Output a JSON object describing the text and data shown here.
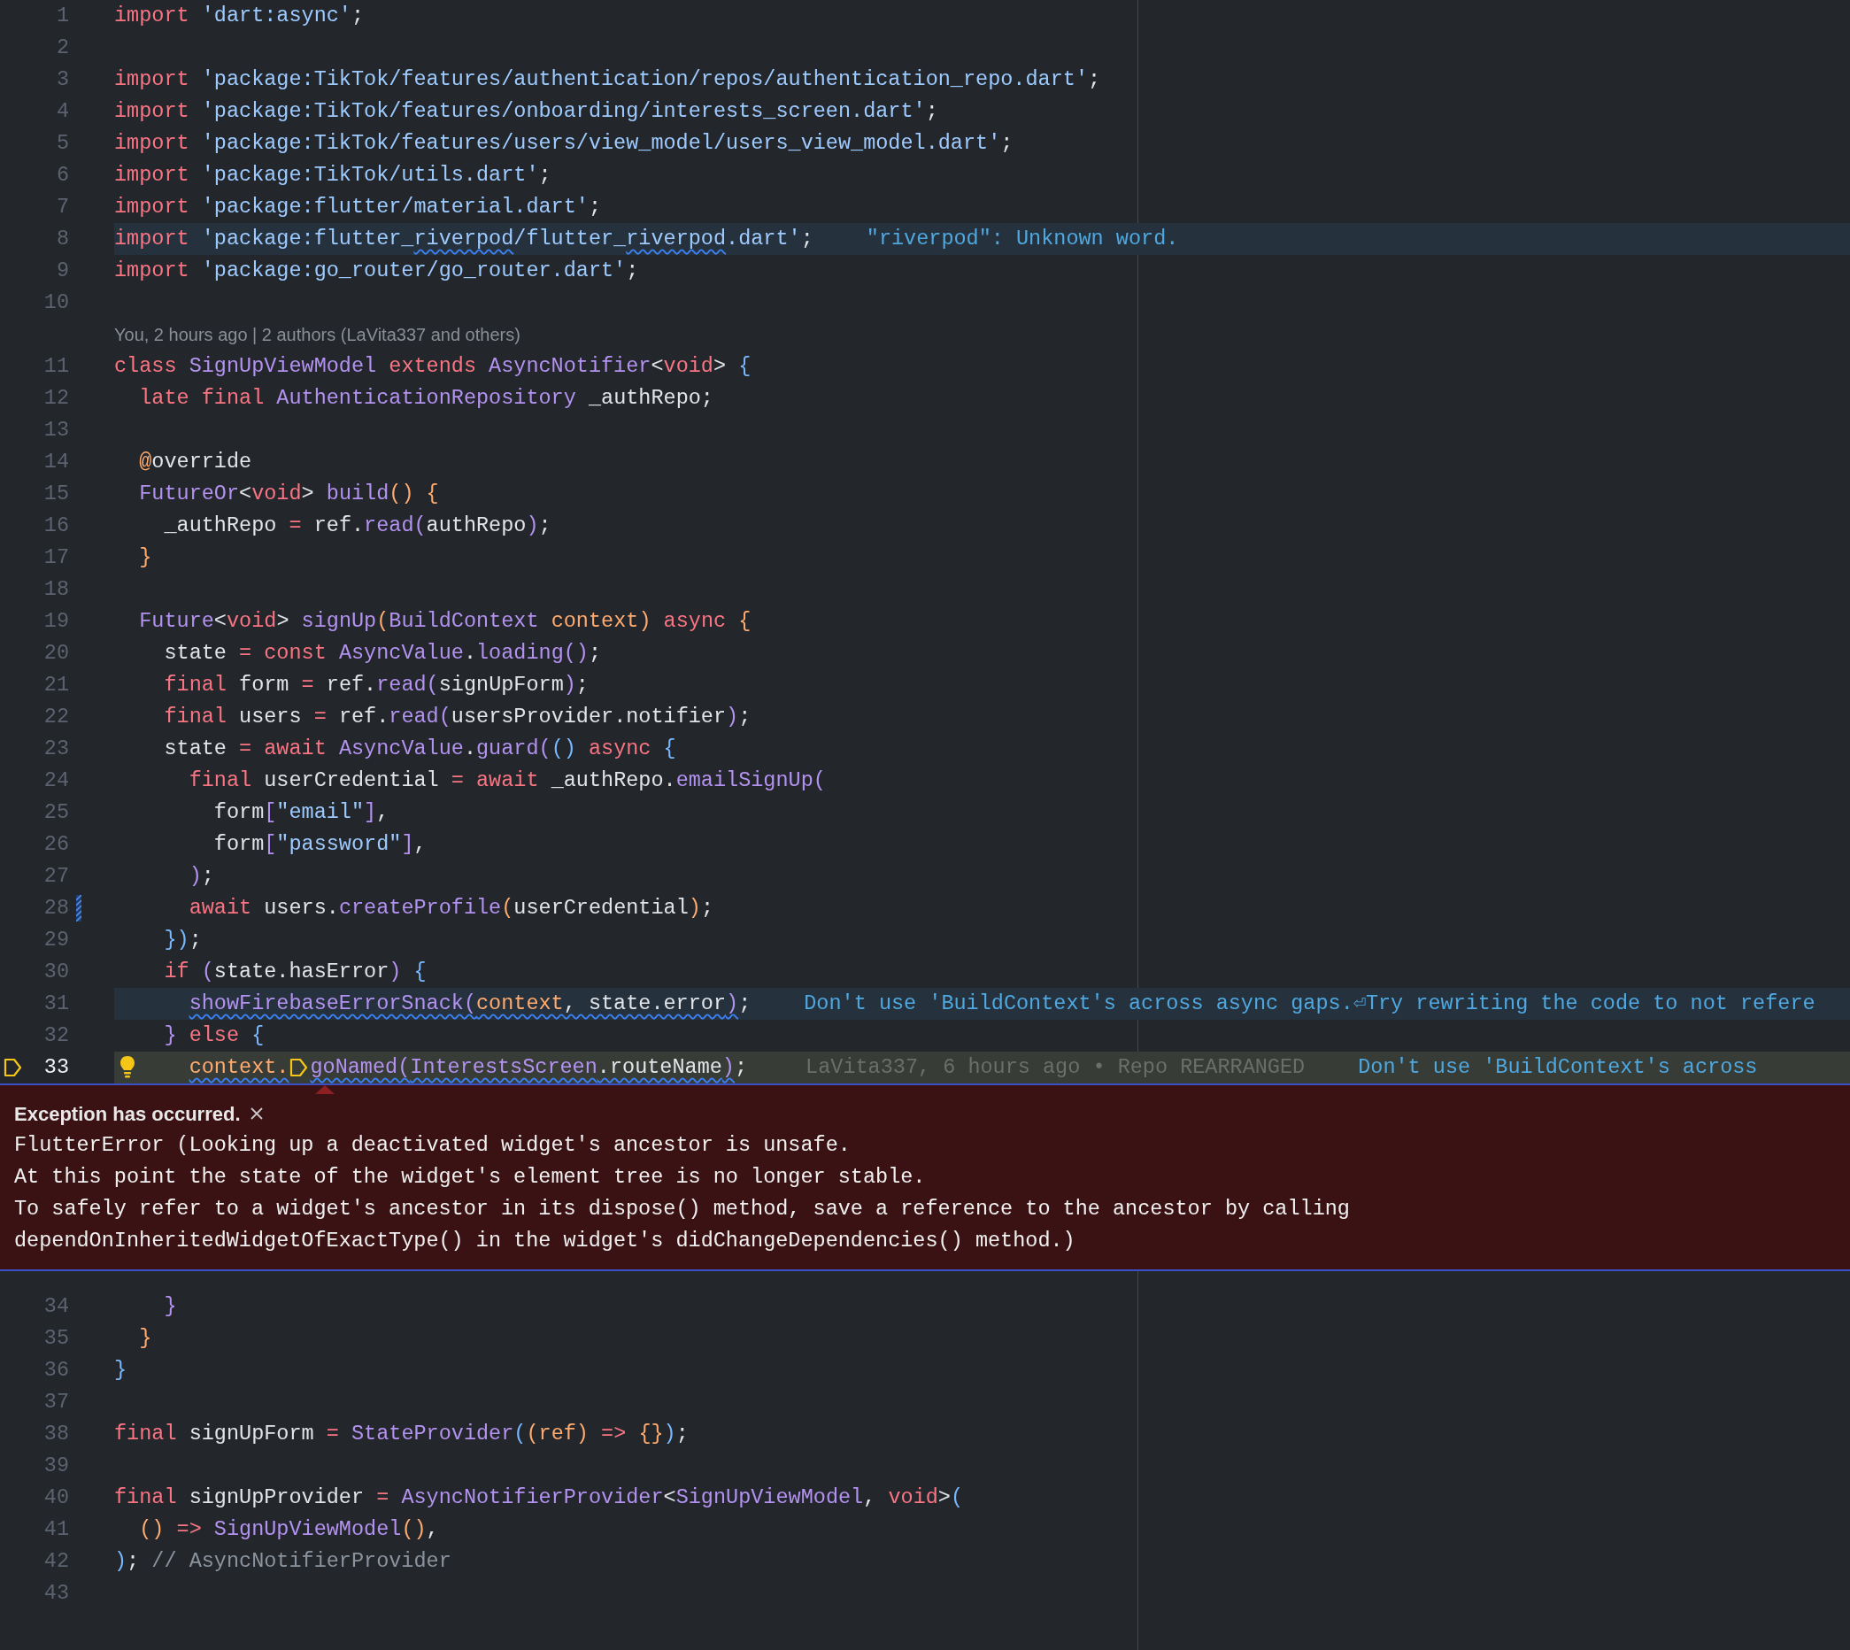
{
  "lines": [
    {
      "number": "1",
      "tokens": [
        {
          "text": "import ",
          "kind": "keyword"
        },
        {
          "text": "'dart:async'",
          "kind": "string"
        },
        {
          "text": ";",
          "kind": "plain"
        }
      ]
    },
    {
      "number": "2"
    },
    {
      "number": "3",
      "tokens": [
        {
          "text": "import ",
          "kind": "keyword"
        },
        {
          "text": "'package:TikTok/features/authentication/repos/authentication_repo.dart'",
          "kind": "string"
        },
        {
          "text": ";",
          "kind": "plain"
        }
      ]
    },
    {
      "number": "4",
      "tokens": [
        {
          "text": "import ",
          "kind": "keyword"
        },
        {
          "text": "'package:TikTok/features/onboarding/interests_screen.dart'",
          "kind": "string"
        },
        {
          "text": ";",
          "kind": "plain"
        }
      ]
    },
    {
      "number": "5",
      "tokens": [
        {
          "text": "import ",
          "kind": "keyword"
        },
        {
          "text": "'package:TikTok/features/users/view_model/users_view_model.dart'",
          "kind": "string"
        },
        {
          "text": ";",
          "kind": "plain"
        }
      ]
    },
    {
      "number": "6",
      "tokens": [
        {
          "text": "import ",
          "kind": "keyword"
        },
        {
          "text": "'package:TikTok/utils.dart'",
          "kind": "string"
        },
        {
          "text": ";",
          "kind": "plain"
        }
      ]
    },
    {
      "number": "7",
      "tokens": [
        {
          "text": "import ",
          "kind": "keyword"
        },
        {
          "text": "'package:flutter/material.dart'",
          "kind": "string"
        },
        {
          "text": ";",
          "kind": "plain"
        }
      ]
    },
    {
      "number": "8",
      "highlighted": true,
      "tokens": [
        {
          "text": "import ",
          "kind": "keyword"
        },
        {
          "text": "'package:flutter_",
          "kind": "string"
        },
        {
          "text": "riverpod",
          "kind": "string",
          "squiggle": true
        },
        {
          "text": "/flutter_",
          "kind": "string"
        },
        {
          "text": "riverpod",
          "kind": "string",
          "squiggle": true
        },
        {
          "text": ".dart'",
          "kind": "string"
        },
        {
          "text": ";",
          "kind": "plain"
        }
      ],
      "hints": [
        {
          "kind": "diagnostic",
          "text": "\"riverpod\": Unknown word."
        }
      ]
    },
    {
      "number": "9",
      "tokens": [
        {
          "text": "import ",
          "kind": "keyword"
        },
        {
          "text": "'package:go_router/go_router.dart'",
          "kind": "string"
        },
        {
          "text": ";",
          "kind": "plain"
        }
      ]
    },
    {
      "number": "10"
    },
    {
      "number": "11",
      "codelens": "You, 2 hours ago | 2 authors (LaVita337 and others)",
      "tokens": [
        {
          "text": "class ",
          "kind": "keyword"
        },
        {
          "text": "SignUpViewModel",
          "kind": "type"
        },
        {
          "text": " extends ",
          "kind": "keyword"
        },
        {
          "text": "AsyncNotifier",
          "kind": "type"
        },
        {
          "text": "<",
          "kind": "plain"
        },
        {
          "text": "void",
          "kind": "keyword"
        },
        {
          "text": "> ",
          "kind": "plain"
        },
        {
          "text": "{",
          "kind": "bracket"
        }
      ]
    },
    {
      "number": "12",
      "tokens": [
        {
          "text": "  late final ",
          "kind": "keyword"
        },
        {
          "text": "AuthenticationRepository",
          "kind": "type"
        },
        {
          "text": " _authRepo;",
          "kind": "plain"
        }
      ]
    },
    {
      "number": "13"
    },
    {
      "number": "14",
      "tokens": [
        {
          "text": "  @",
          "kind": "accent"
        },
        {
          "text": "override",
          "kind": "plain"
        }
      ]
    },
    {
      "number": "15",
      "tokens": [
        {
          "text": "  FutureOr",
          "kind": "type"
        },
        {
          "text": "<",
          "kind": "plain"
        },
        {
          "text": "void",
          "kind": "keyword"
        },
        {
          "text": "> ",
          "kind": "plain"
        },
        {
          "text": "build",
          "kind": "type"
        },
        {
          "text": "() {",
          "kind": "accent"
        }
      ]
    },
    {
      "number": "16",
      "tokens": [
        {
          "text": "    _authRepo ",
          "kind": "plain"
        },
        {
          "text": "= ",
          "kind": "keyword"
        },
        {
          "text": "ref.",
          "kind": "plain"
        },
        {
          "text": "read(",
          "kind": "type"
        },
        {
          "text": "authRepo",
          "kind": "plain"
        },
        {
          "text": ")",
          "kind": "type"
        },
        {
          "text": ";",
          "kind": "plain"
        }
      ]
    },
    {
      "number": "17",
      "tokens": [
        {
          "text": "  }",
          "kind": "accent"
        }
      ]
    },
    {
      "number": "18"
    },
    {
      "number": "19",
      "tokens": [
        {
          "text": "  Future",
          "kind": "type"
        },
        {
          "text": "<",
          "kind": "plain"
        },
        {
          "text": "void",
          "kind": "keyword"
        },
        {
          "text": "> ",
          "kind": "plain"
        },
        {
          "text": "signUp",
          "kind": "type"
        },
        {
          "text": "(",
          "kind": "accent"
        },
        {
          "text": "BuildContext",
          "kind": "type"
        },
        {
          "text": " context)",
          "kind": "accent"
        },
        {
          "text": " async ",
          "kind": "keyword"
        },
        {
          "text": "{",
          "kind": "accent"
        }
      ]
    },
    {
      "number": "20",
      "tokens": [
        {
          "text": "    state ",
          "kind": "plain"
        },
        {
          "text": "= const ",
          "kind": "keyword"
        },
        {
          "text": "AsyncValue",
          "kind": "type"
        },
        {
          "text": ".",
          "kind": "plain"
        },
        {
          "text": "loading()",
          "kind": "type"
        },
        {
          "text": ";",
          "kind": "plain"
        }
      ]
    },
    {
      "number": "21",
      "tokens": [
        {
          "text": "    final ",
          "kind": "keyword"
        },
        {
          "text": "form ",
          "kind": "plain"
        },
        {
          "text": "= ",
          "kind": "keyword"
        },
        {
          "text": "ref.",
          "kind": "plain"
        },
        {
          "text": "read(",
          "kind": "type"
        },
        {
          "text": "signUpForm",
          "kind": "plain"
        },
        {
          "text": ")",
          "kind": "type"
        },
        {
          "text": ";",
          "kind": "plain"
        }
      ]
    },
    {
      "number": "22",
      "tokens": [
        {
          "text": "    final ",
          "kind": "keyword"
        },
        {
          "text": "users ",
          "kind": "plain"
        },
        {
          "text": "= ",
          "kind": "keyword"
        },
        {
          "text": "ref.",
          "kind": "plain"
        },
        {
          "text": "read(",
          "kind": "type"
        },
        {
          "text": "usersProvider.notifier",
          "kind": "plain"
        },
        {
          "text": ")",
          "kind": "type"
        },
        {
          "text": ";",
          "kind": "plain"
        }
      ]
    },
    {
      "number": "23",
      "tokens": [
        {
          "text": "    state ",
          "kind": "plain"
        },
        {
          "text": "= await ",
          "kind": "keyword"
        },
        {
          "text": "AsyncValue",
          "kind": "type"
        },
        {
          "text": ".",
          "kind": "plain"
        },
        {
          "text": "guard(",
          "kind": "type"
        },
        {
          "text": "()",
          "kind": "bracket"
        },
        {
          "text": " async ",
          "kind": "keyword"
        },
        {
          "text": "{",
          "kind": "bracket"
        }
      ]
    },
    {
      "number": "24",
      "tokens": [
        {
          "text": "      final ",
          "kind": "keyword"
        },
        {
          "text": "userCredential ",
          "kind": "plain"
        },
        {
          "text": "= await ",
          "kind": "keyword"
        },
        {
          "text": "_authRepo.",
          "kind": "plain"
        },
        {
          "text": "emailSignUp(",
          "kind": "type"
        }
      ]
    },
    {
      "number": "25",
      "tokens": [
        {
          "text": "        form",
          "kind": "plain"
        },
        {
          "text": "[",
          "kind": "type"
        },
        {
          "text": "\"email\"",
          "kind": "string"
        },
        {
          "text": "]",
          "kind": "type"
        },
        {
          "text": ",",
          "kind": "plain"
        }
      ]
    },
    {
      "number": "26",
      "tokens": [
        {
          "text": "        form",
          "kind": "plain"
        },
        {
          "text": "[",
          "kind": "type"
        },
        {
          "text": "\"password\"",
          "kind": "string"
        },
        {
          "text": "]",
          "kind": "type"
        },
        {
          "text": ",",
          "kind": "plain"
        }
      ]
    },
    {
      "number": "27",
      "tokens": [
        {
          "text": "      )",
          "kind": "type"
        },
        {
          "text": ";",
          "kind": "plain"
        }
      ]
    },
    {
      "number": "28",
      "changed": true,
      "tokens": [
        {
          "text": "      await ",
          "kind": "keyword"
        },
        {
          "text": "users.",
          "kind": "plain"
        },
        {
          "text": "createProfile",
          "kind": "type"
        },
        {
          "text": "(",
          "kind": "accent"
        },
        {
          "text": "userCredential",
          "kind": "plain"
        },
        {
          "text": ")",
          "kind": "accent"
        },
        {
          "text": ";",
          "kind": "plain"
        }
      ]
    },
    {
      "number": "29",
      "tokens": [
        {
          "text": "    })",
          "kind": "bracket"
        },
        {
          "text": ";",
          "kind": "plain"
        }
      ]
    },
    {
      "number": "30",
      "tokens": [
        {
          "text": "    if ",
          "kind": "keyword"
        },
        {
          "text": "(",
          "kind": "type"
        },
        {
          "text": "state.hasError",
          "kind": "plain"
        },
        {
          "text": ") ",
          "kind": "type"
        },
        {
          "text": "{",
          "kind": "bracket"
        }
      ]
    },
    {
      "number": "31",
      "highlighted": true,
      "tokens": [
        {
          "text": "      showFirebaseErrorSnack(",
          "kind": "type",
          "squiggle": true
        },
        {
          "text": "context",
          "kind": "accent",
          "squiggle": true
        },
        {
          "text": ", state.error",
          "kind": "plain",
          "squiggle": true
        },
        {
          "text": ")",
          "kind": "type",
          "squiggle": true
        },
        {
          "text": ";",
          "kind": "plain"
        }
      ],
      "hints": [
        {
          "kind": "diagnostic",
          "text": "Don't use 'BuildContext's across async gaps.⏎Try rewriting the code to not refere"
        }
      ]
    },
    {
      "number": "32",
      "tokens": [
        {
          "text": "    }",
          "kind": "type"
        },
        {
          "text": " else ",
          "kind": "keyword"
        },
        {
          "text": "{",
          "kind": "bracket"
        }
      ]
    },
    {
      "number": "33",
      "paused": true,
      "breakpoint": true,
      "lightbulb": true,
      "tokens": [
        {
          "text": "      context.",
          "kind": "accent",
          "squiggle": true
        },
        {
          "kind": "stop"
        },
        {
          "text": "goNamed(",
          "kind": "type",
          "squiggle": true
        },
        {
          "text": "InterestsScreen",
          "kind": "type",
          "squiggle": true
        },
        {
          "text": ".routeName",
          "kind": "plain",
          "squiggle": true
        },
        {
          "text": ")",
          "kind": "type",
          "squiggle": true
        },
        {
          "text": ";",
          "kind": "plain"
        }
      ],
      "hints": [
        {
          "kind": "blame",
          "text": "LaVita337, 6 hours ago • Repo REARRANGED"
        },
        {
          "kind": "diagnostic",
          "text": "Don't use 'BuildContext's across"
        }
      ]
    }
  ],
  "exception": {
    "title": "Exception has occurred.",
    "lines": [
      "FlutterError (Looking up a deactivated widget's ancestor is unsafe.",
      "At this point the state of the widget's element tree is no longer stable.",
      "To safely refer to a widget's ancestor in its dispose() method, save a reference to the ancestor by calling",
      "dependOnInheritedWidgetOfExactType() in the widget's didChangeDependencies() method.)"
    ]
  },
  "lines_below": [
    {
      "number": "34",
      "tokens": [
        {
          "text": "    }",
          "kind": "type"
        }
      ]
    },
    {
      "number": "35",
      "tokens": [
        {
          "text": "  }",
          "kind": "accent"
        }
      ]
    },
    {
      "number": "36",
      "tokens": [
        {
          "text": "}",
          "kind": "bracket"
        }
      ]
    },
    {
      "number": "37"
    },
    {
      "number": "38",
      "tokens": [
        {
          "text": "final ",
          "kind": "keyword"
        },
        {
          "text": "signUpForm ",
          "kind": "plain"
        },
        {
          "text": "= ",
          "kind": "keyword"
        },
        {
          "text": "StateProvider",
          "kind": "type"
        },
        {
          "text": "(",
          "kind": "bracket"
        },
        {
          "text": "(ref) ",
          "kind": "accent"
        },
        {
          "text": "=> ",
          "kind": "keyword"
        },
        {
          "text": "{}",
          "kind": "accent"
        },
        {
          "text": ")",
          "kind": "bracket"
        },
        {
          "text": ";",
          "kind": "plain"
        }
      ]
    },
    {
      "number": "39"
    },
    {
      "number": "40",
      "tokens": [
        {
          "text": "final ",
          "kind": "keyword"
        },
        {
          "text": "signUpProvider ",
          "kind": "plain"
        },
        {
          "text": "= ",
          "kind": "keyword"
        },
        {
          "text": "AsyncNotifierProvider",
          "kind": "type"
        },
        {
          "text": "<",
          "kind": "plain"
        },
        {
          "text": "SignUpViewModel",
          "kind": "type"
        },
        {
          "text": ", ",
          "kind": "plain"
        },
        {
          "text": "void",
          "kind": "keyword"
        },
        {
          "text": ">",
          "kind": "plain"
        },
        {
          "text": "(",
          "kind": "bracket"
        }
      ]
    },
    {
      "number": "41",
      "tokens": [
        {
          "text": "  () ",
          "kind": "accent"
        },
        {
          "text": "=> ",
          "kind": "keyword"
        },
        {
          "text": "SignUpViewModel",
          "kind": "type"
        },
        {
          "text": "()",
          "kind": "accent"
        },
        {
          "text": ",",
          "kind": "plain"
        }
      ]
    },
    {
      "number": "42",
      "tokens": [
        {
          "text": ")",
          "kind": "bracket"
        },
        {
          "text": "; ",
          "kind": "plain"
        },
        {
          "text": "// AsyncNotifierProvider",
          "kind": "comment"
        }
      ]
    },
    {
      "number": "43"
    }
  ]
}
